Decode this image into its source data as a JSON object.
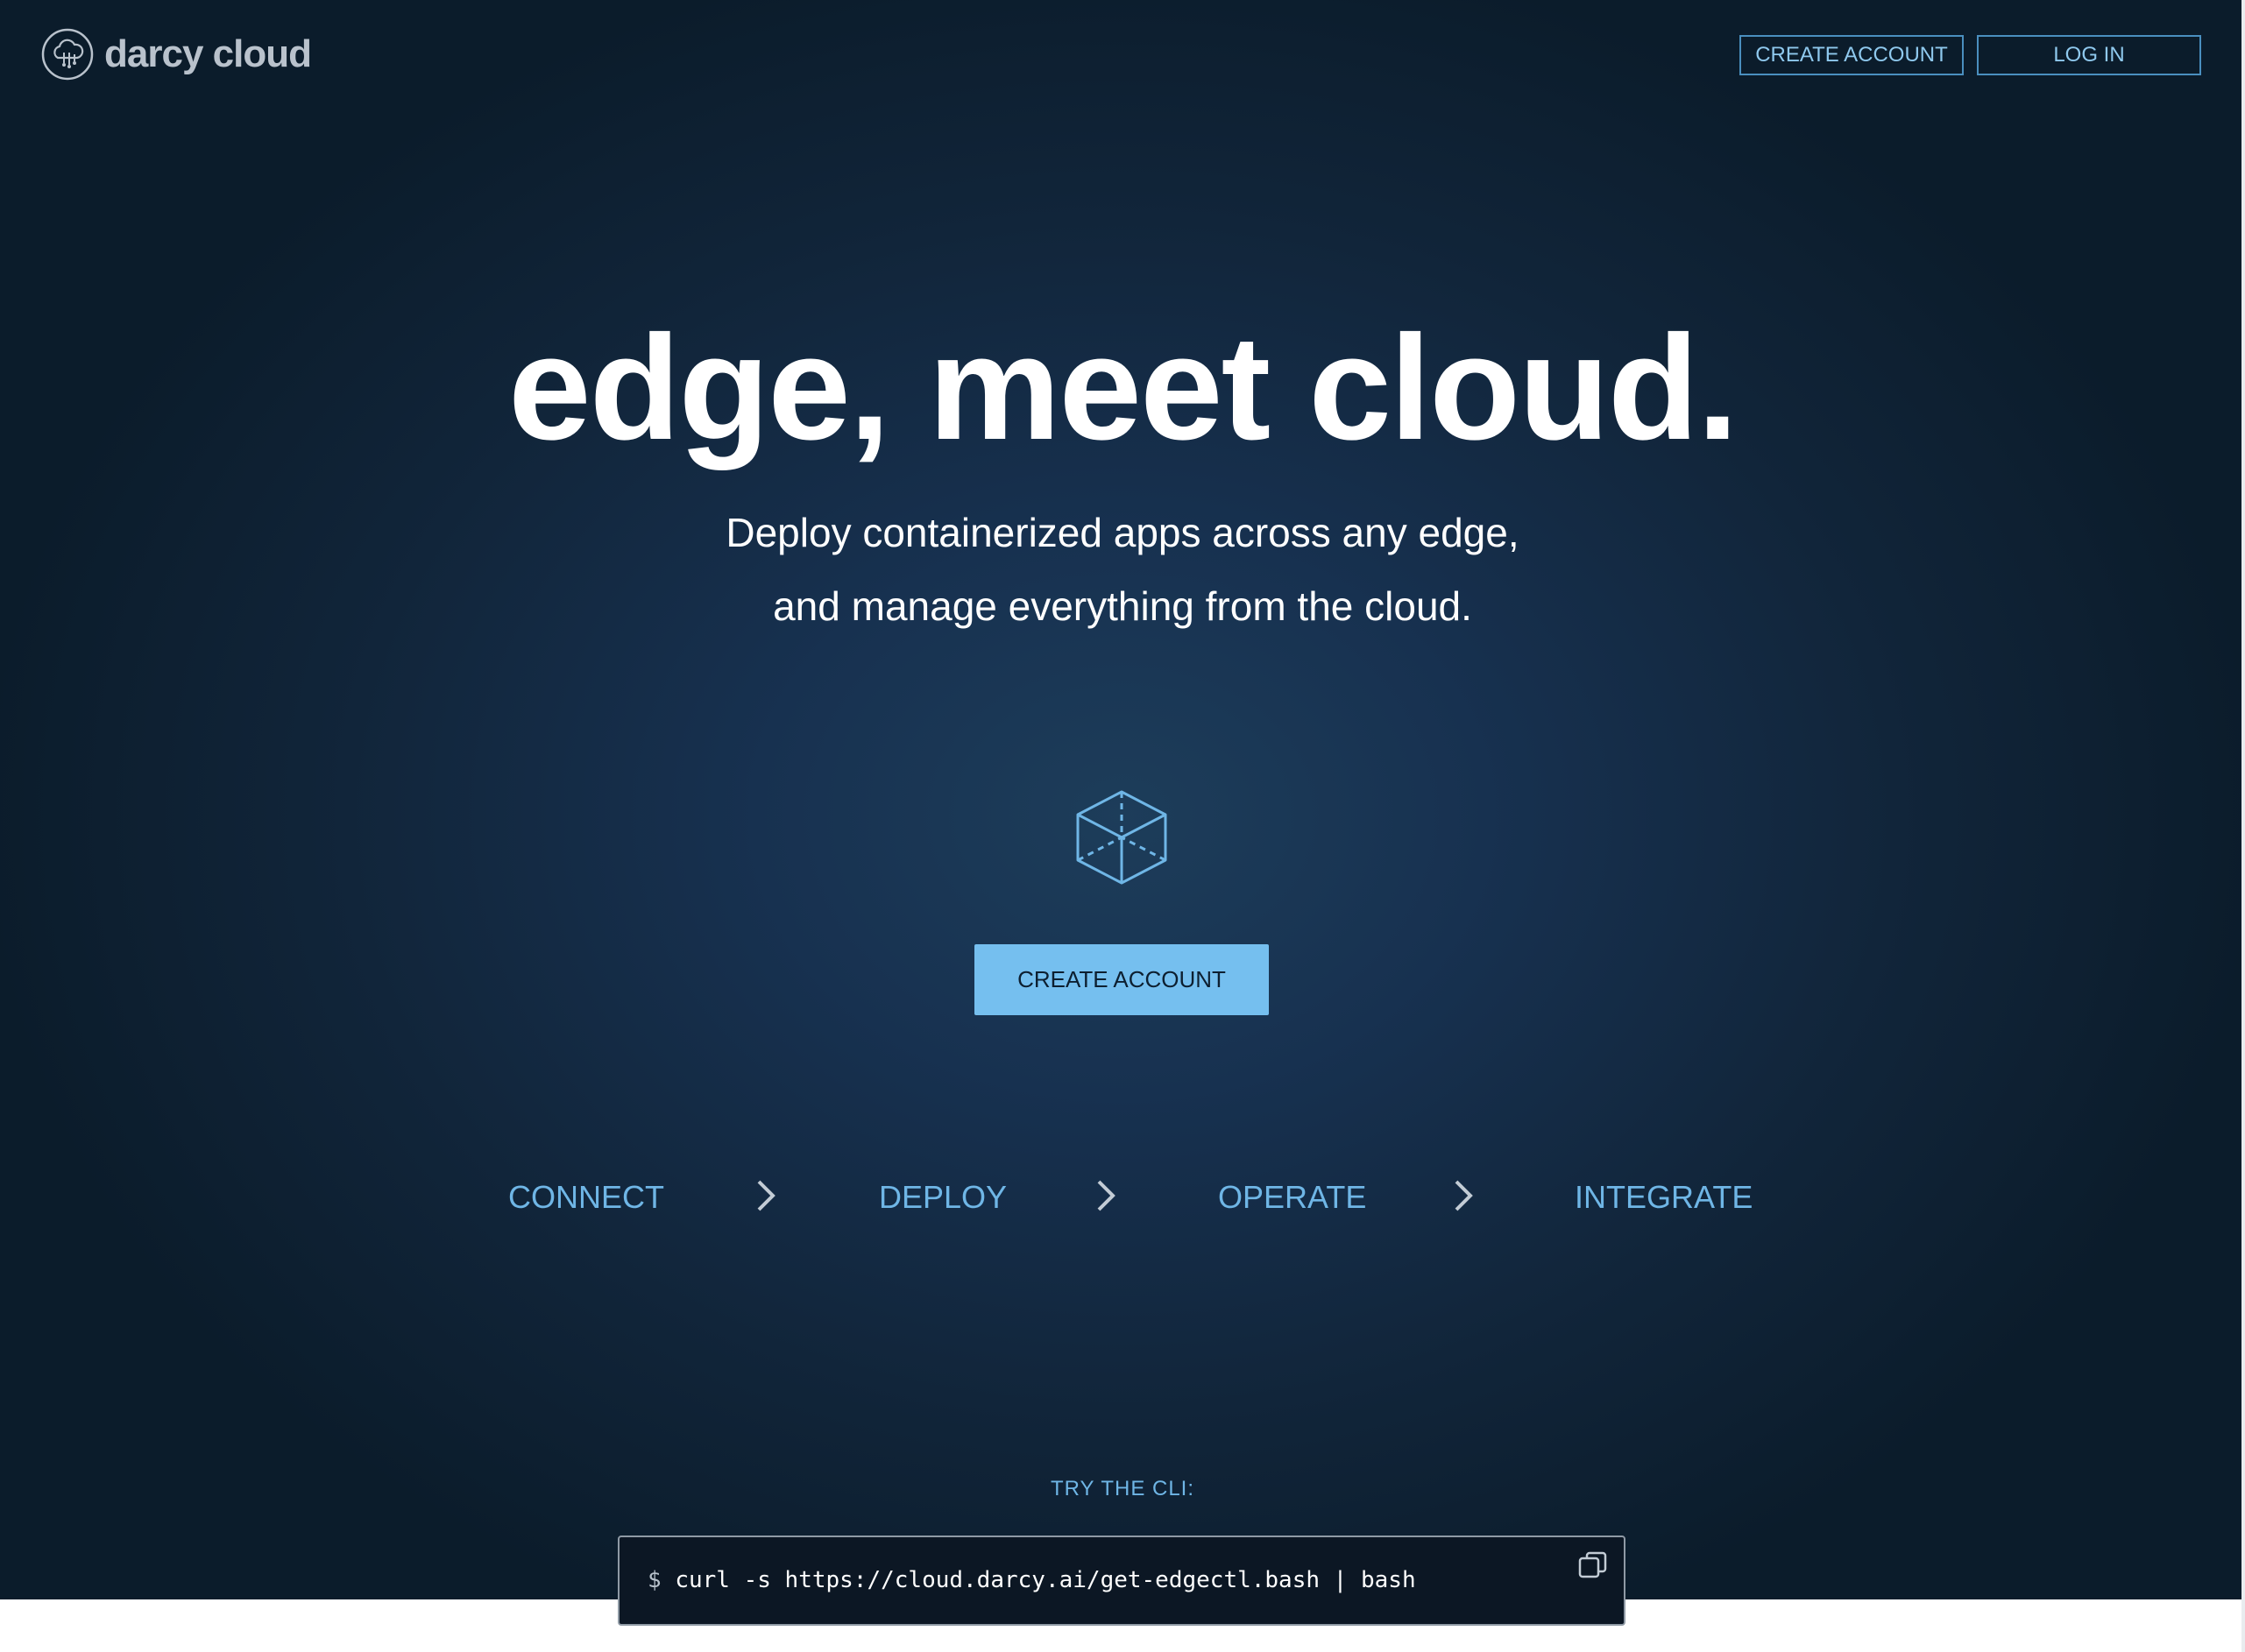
{
  "header": {
    "brand": "darcy cloud",
    "create_account_label": "CREATE ACCOUNT",
    "login_label": "LOG IN"
  },
  "hero": {
    "headline": "edge, meet cloud.",
    "subline_1": "Deploy containerized apps across any edge,",
    "subline_2": "and manage everything from the cloud.",
    "cta_label": "CREATE ACCOUNT"
  },
  "steps": [
    {
      "label": "CONNECT"
    },
    {
      "label": "DEPLOY"
    },
    {
      "label": "OPERATE"
    },
    {
      "label": "INTEGRATE"
    }
  ],
  "cli": {
    "label": "TRY THE CLI:",
    "prompt": "$",
    "command": "curl -s https://cloud.darcy.ai/get-edgectl.bash | bash"
  },
  "icons": {
    "logo": "cloud-logo-icon",
    "hero": "cube-icon",
    "step_separator": "chevron-right-icon",
    "copy": "copy-icon"
  },
  "colors": {
    "background_dark": "#0b1c2b",
    "background_glow": "#1d3d5a",
    "accent": "#75bfef",
    "step_text": "#6fb6e6",
    "headline": "#ffffff"
  }
}
